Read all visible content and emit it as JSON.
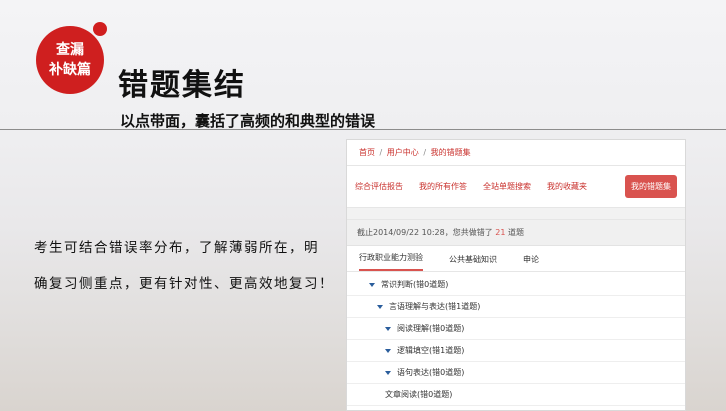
{
  "header": {
    "badge_line1": "查漏",
    "badge_line2": "补缺篇",
    "title": "错题集结",
    "subtitle": "以点带面，囊括了高频的和典型的错误"
  },
  "description": {
    "line1": "考生可结合错误率分布，了解薄弱所在，明",
    "line2": "确复习侧重点，更有针对性、更高效地复习！"
  },
  "panel": {
    "breadcrumb": [
      "首页",
      "用户中心",
      "我的错题集"
    ],
    "breadcrumb_sep": "/",
    "tabs": [
      "综合评估报告",
      "我的所有作答",
      "全站单题搜索",
      "我的收藏夹",
      "我的错题集"
    ],
    "summary_prefix": "截止2014/09/22 10:28，您共做错了",
    "summary_count": "21",
    "summary_suffix": "道题",
    "subtabs": [
      "行政职业能力测验",
      "公共基础知识",
      "申论"
    ],
    "tree": [
      {
        "label": "常识判断(错0道题)",
        "level": 1,
        "caret": true
      },
      {
        "label": "言语理解与表达(错1道题)",
        "level": 2,
        "caret": true
      },
      {
        "label": "阅读理解(错0道题)",
        "level": 3,
        "caret": true
      },
      {
        "label": "逻辑填空(错1道题)",
        "level": 3,
        "caret": true
      },
      {
        "label": "语句表达(错0道题)",
        "level": 3,
        "caret": true
      },
      {
        "label": "文章阅读(错0道题)",
        "level": 4,
        "caret": false
      }
    ]
  },
  "colors": {
    "brand_red": "#cf1f1f",
    "link_red": "#c9302c",
    "active_tab": "#d9534f",
    "caret_blue": "#2a5d9c"
  }
}
